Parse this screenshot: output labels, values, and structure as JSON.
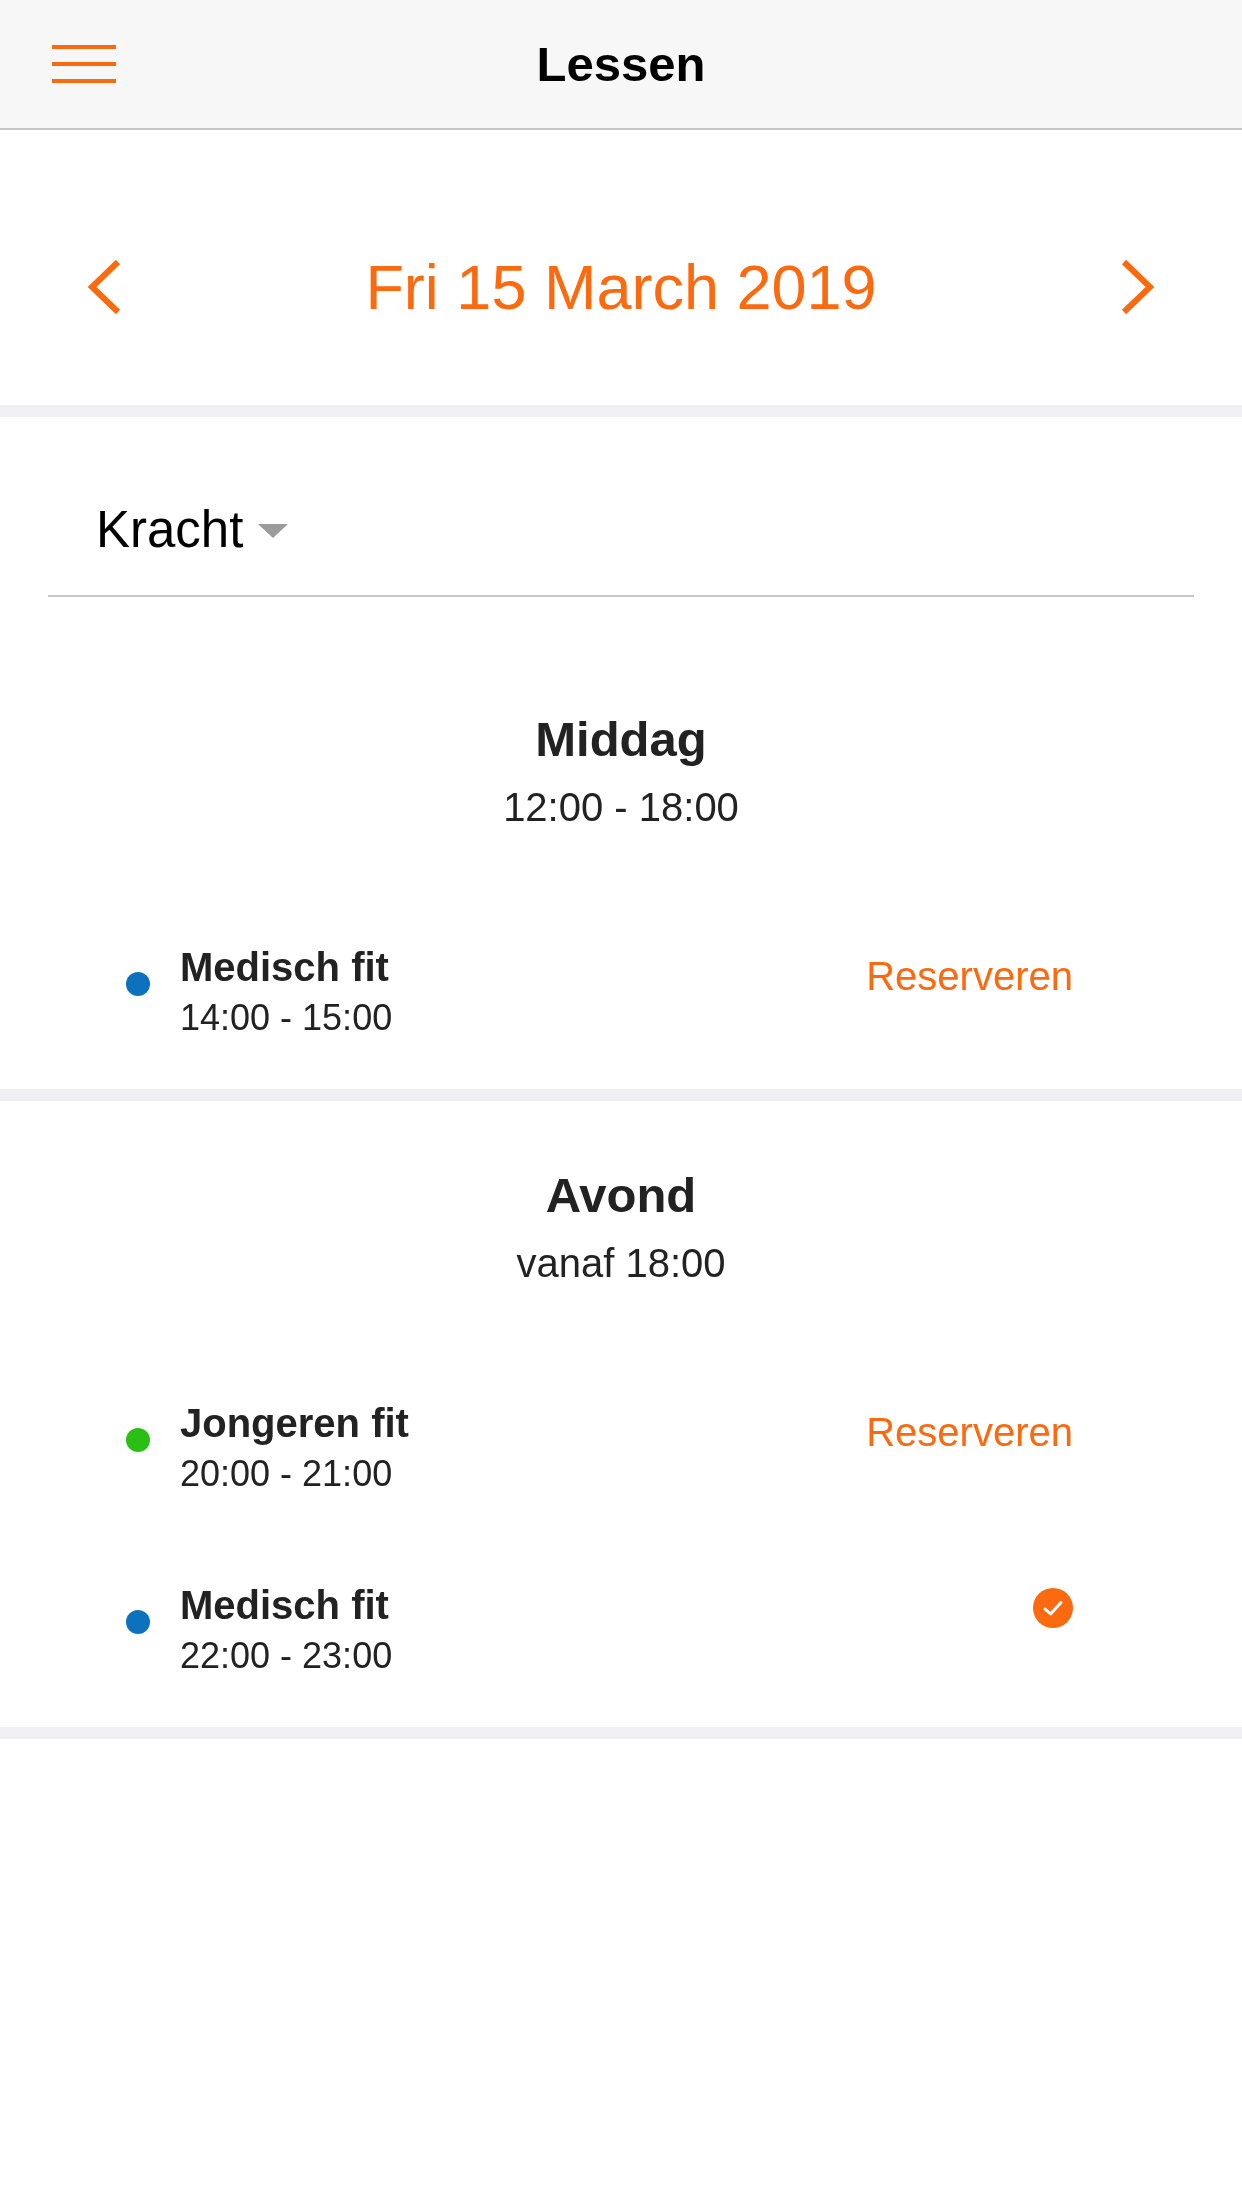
{
  "nav_bar": {
    "title": "Lessen"
  },
  "date_nav": {
    "date": "Fri 15 March 2019"
  },
  "filter": {
    "value": "Kracht"
  },
  "sections": [
    {
      "title": "Middag",
      "time": "12:00 - 18:00",
      "classes": [
        {
          "name": "Medisch fit",
          "time": "14:00 - 15:00",
          "color": "#0b72bb",
          "reserved": false,
          "action": "Reserveren"
        }
      ]
    },
    {
      "title": "Avond",
      "time": "vanaf 18:00",
      "classes": [
        {
          "name": "Jongeren fit",
          "time": "20:00 - 21:00",
          "color": "#2bbf15",
          "reserved": false,
          "action": "Reserveren"
        },
        {
          "name": "Medisch fit",
          "time": "22:00 - 23:00",
          "color": "#0b72bb",
          "reserved": true
        }
      ]
    }
  ]
}
